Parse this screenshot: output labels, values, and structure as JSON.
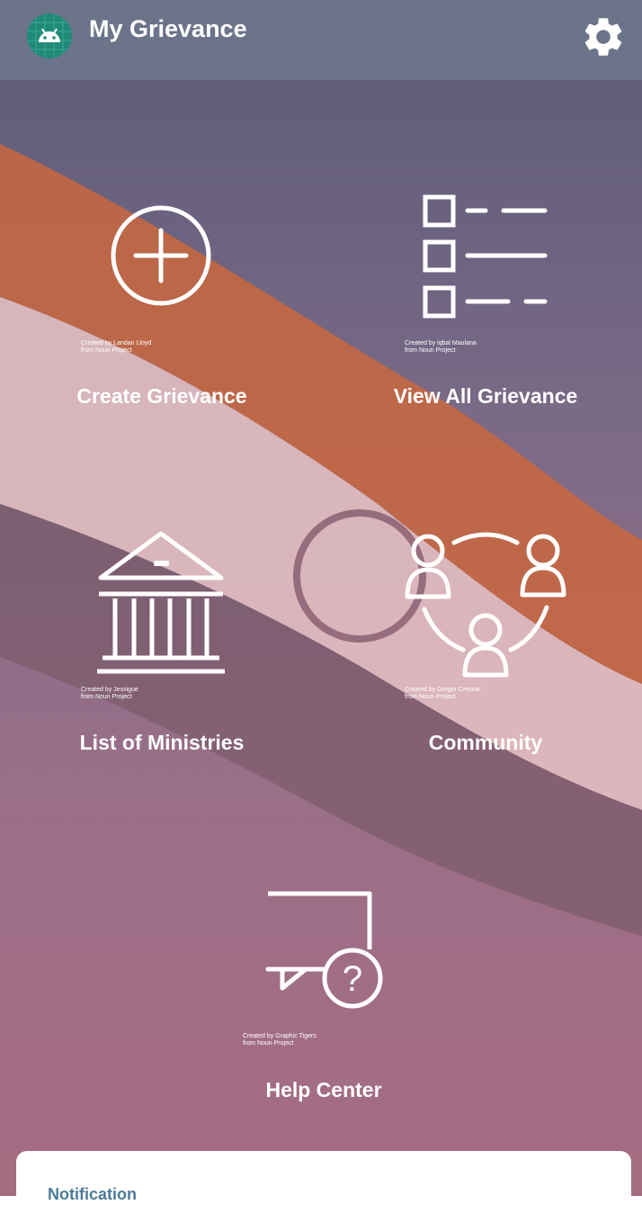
{
  "appbar": {
    "title": "My Grievance",
    "logo_icon": "android-icon",
    "settings_icon": "gear-icon"
  },
  "tiles": [
    {
      "label": "Create Grievance",
      "icon": "add-circle-icon",
      "credit_line1": "Created by Landan Lloyd",
      "credit_line2": "from Noun Project"
    },
    {
      "label": "View All Grievance",
      "icon": "checklist-icon",
      "credit_line1": "Created by iqbal Maulana",
      "credit_line2": "from Noun Project"
    },
    {
      "label": "List of Ministries",
      "icon": "government-building-icon",
      "credit_line1": "Created by Jessigue",
      "credit_line2": "from Noun Project"
    },
    {
      "label": "Community",
      "icon": "community-icon",
      "credit_line1": "Created by Gregor Cresnar",
      "credit_line2": "from Noun Project"
    },
    {
      "label": "Help Center",
      "icon": "help-chat-icon",
      "credit_line1": "Created by Graphic Tigers",
      "credit_line2": "from Noun Project"
    }
  ],
  "notification": {
    "title": "Notification"
  },
  "colors": {
    "appbar": "#6e768c",
    "card_title": "#4c7a96",
    "logo_bg": "#1f8a78"
  }
}
